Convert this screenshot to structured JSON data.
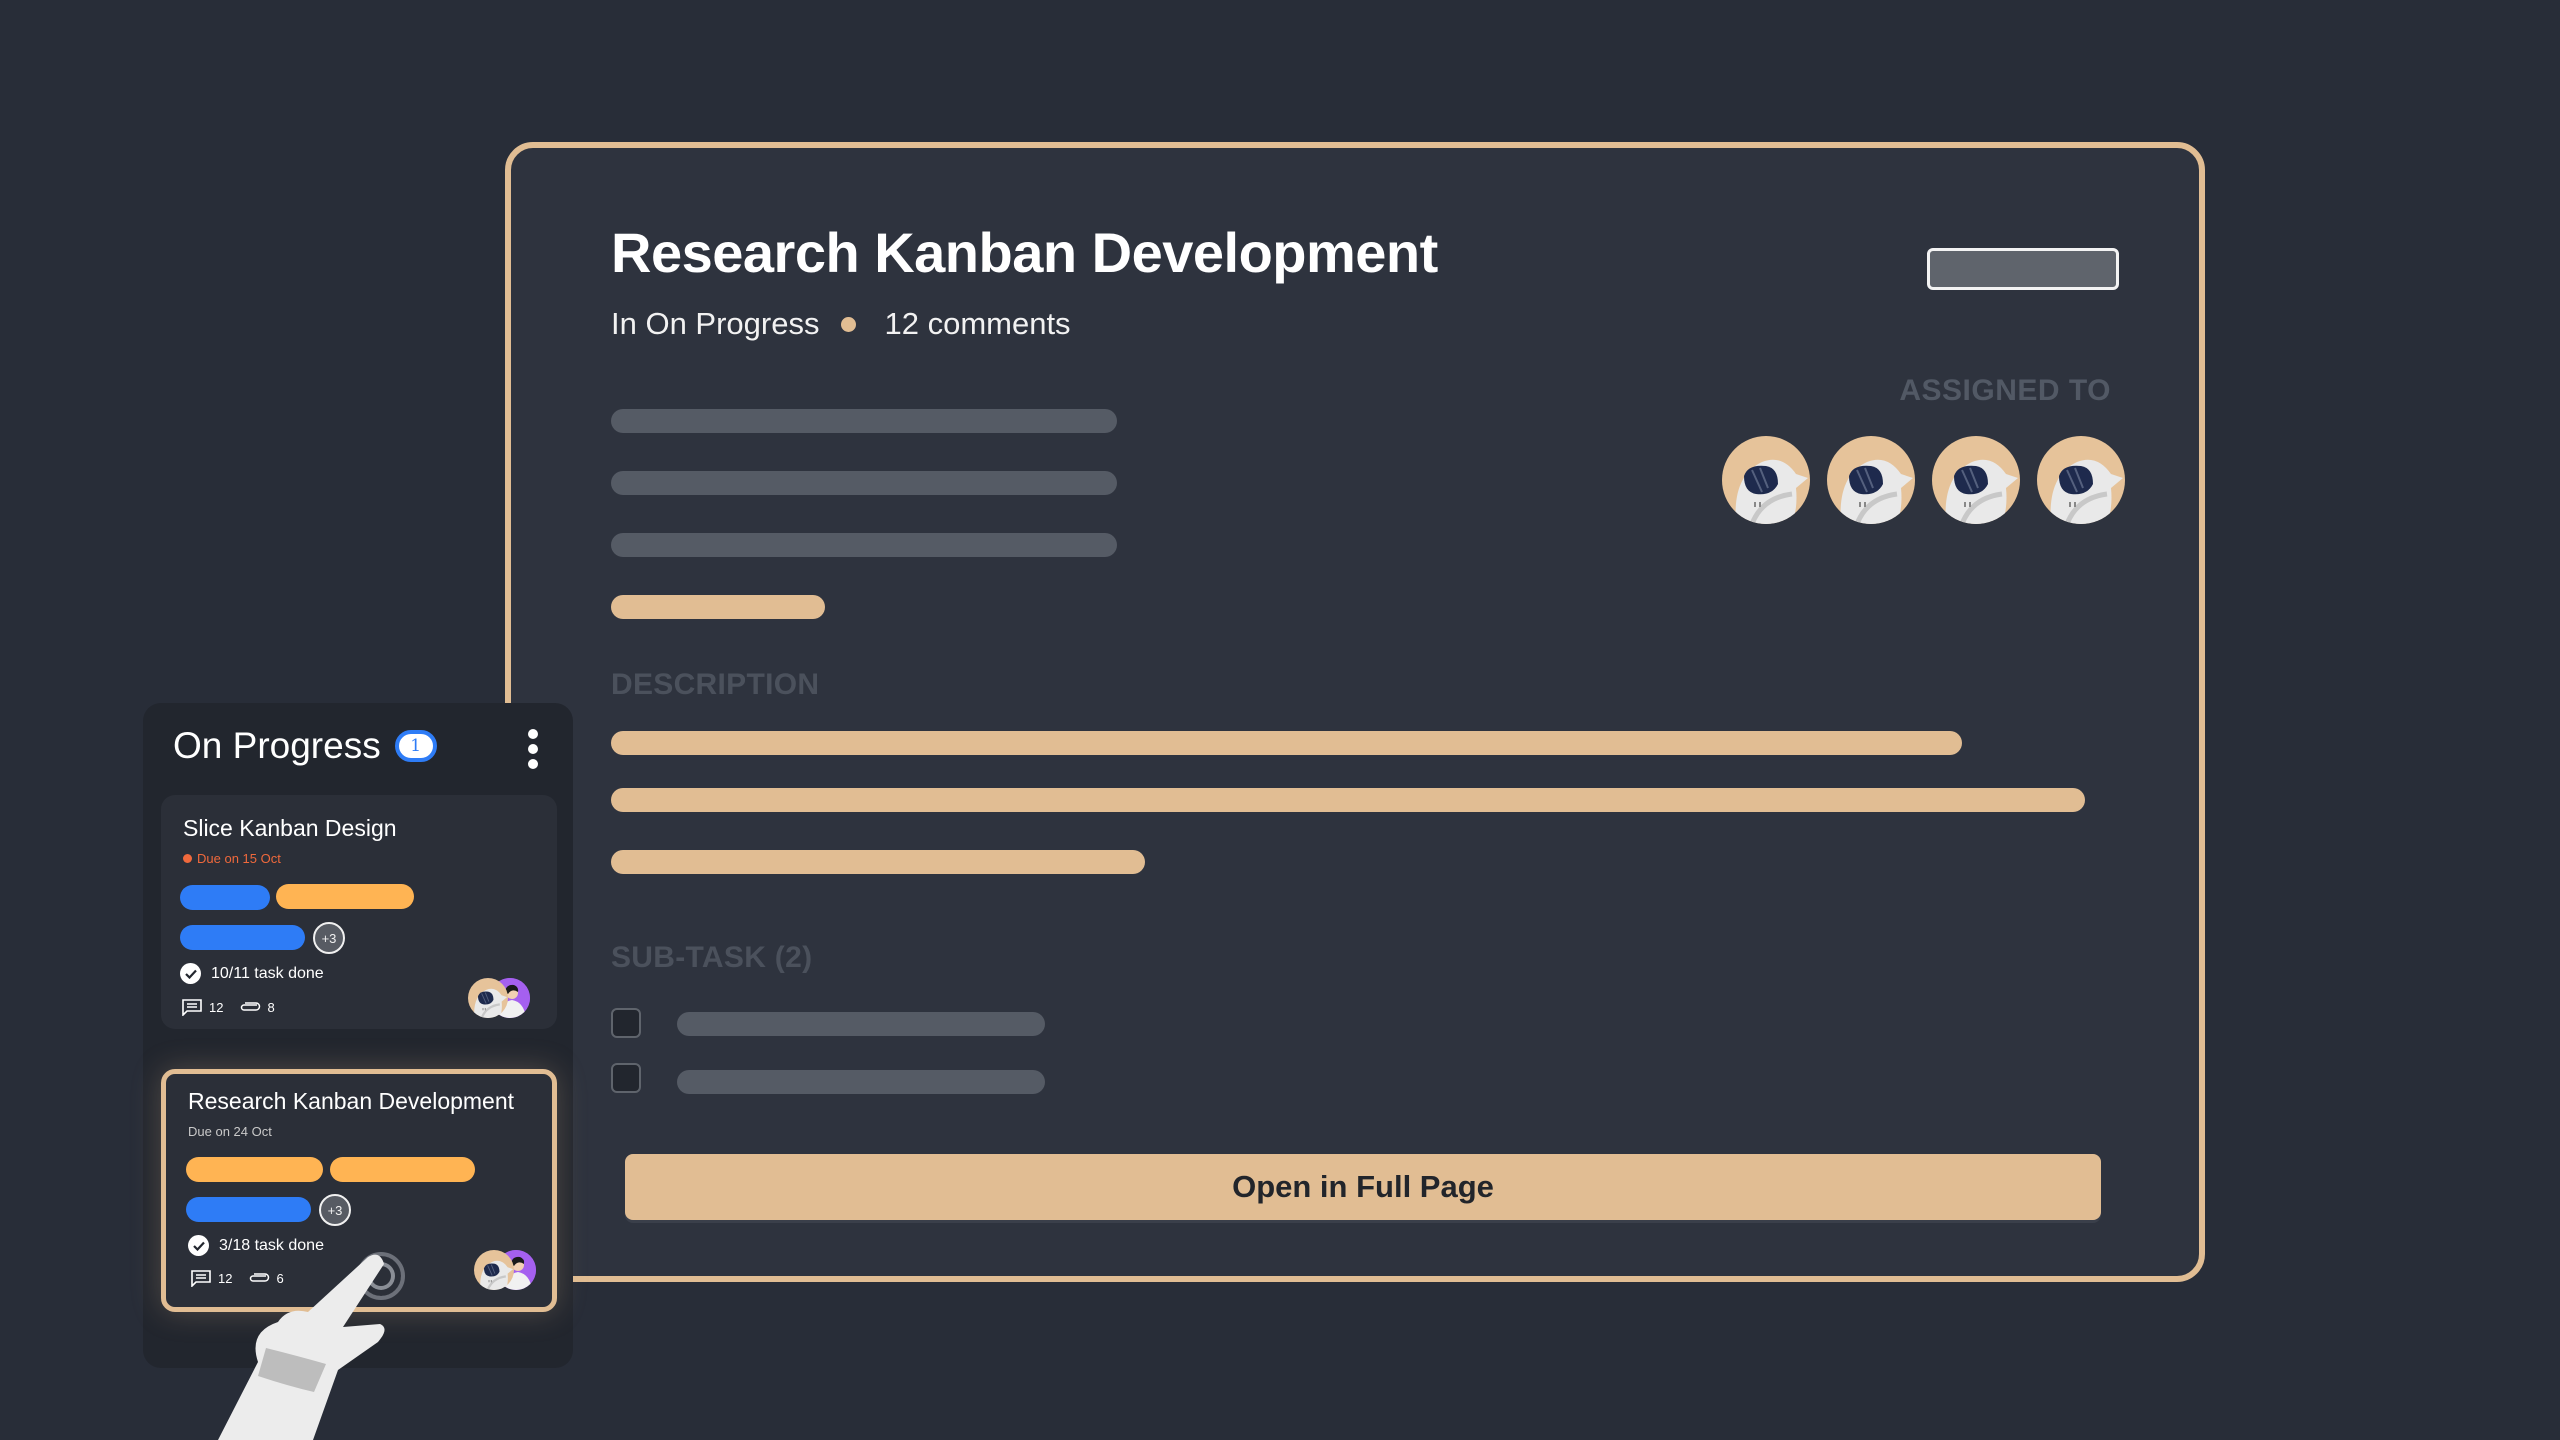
{
  "detail": {
    "title": "Research Kanban Development",
    "status": "In On Progress",
    "comments": "12 comments",
    "assigned_label": "ASSIGNED TO",
    "assignees": [
      {
        "avatar": "astronaut-avatar"
      },
      {
        "avatar": "astronaut-avatar"
      },
      {
        "avatar": "astronaut-avatar"
      },
      {
        "avatar": "astronaut-avatar"
      }
    ],
    "description_label": "DESCRIPTION",
    "subtask_label": "SUB-TASK (2)",
    "subtasks": [
      {
        "checked": false
      },
      {
        "checked": false
      }
    ],
    "open_button": "Open in Full Page"
  },
  "column": {
    "title": "On Progress",
    "count": "1",
    "cards": [
      {
        "title": "Slice Kanban Design",
        "due": "Due on 15 Oct",
        "due_color": "#f0693c",
        "more_tags": "+3",
        "tasks": "10/11 task done",
        "comments": "12",
        "attachments": "8",
        "selected": false
      },
      {
        "title": "Research Kanban Development",
        "due": "Due on 24 Oct",
        "due_color": "#c9c9c9",
        "more_tags": "+3",
        "tasks": "3/18 task done",
        "comments": "12",
        "attachments": "6",
        "selected": true
      }
    ]
  },
  "colors": {
    "background": "#282d38",
    "panel": "#2e333e",
    "accent_tan": "#e1bd93",
    "tag_blue": "#2e7cf6",
    "tag_orange": "#ffb453",
    "skeleton_gray": "#555b65",
    "due_red": "#f0693c"
  }
}
